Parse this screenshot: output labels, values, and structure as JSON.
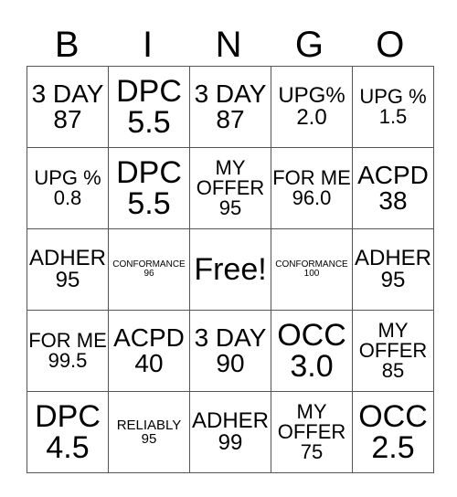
{
  "header": {
    "letters": [
      "B",
      "I",
      "N",
      "G",
      "O"
    ]
  },
  "card": {
    "rows": [
      [
        {
          "text": "3 DAY 87",
          "size": "l"
        },
        {
          "text": "DPC 5.5",
          "size": "xl"
        },
        {
          "text": "3 DAY 87",
          "size": "l"
        },
        {
          "text": "UPG% 2.0",
          "size": "m"
        },
        {
          "text": "UPG % 1.5",
          "size": "ms"
        }
      ],
      [
        {
          "text": "UPG % 0.8",
          "size": "ms"
        },
        {
          "text": "DPC 5.5",
          "size": "xl"
        },
        {
          "text": "MY OFFER 95",
          "size": "ms"
        },
        {
          "text": "FOR ME 96.0",
          "size": "ms"
        },
        {
          "text": "ACPD 38",
          "size": "l"
        }
      ],
      [
        {
          "text": "ADHER 95",
          "size": "m"
        },
        {
          "text": "CONFORMANCE 96",
          "size": "xs"
        },
        {
          "text": "Free!",
          "size": "xl"
        },
        {
          "text": "CONFORMANCE 100",
          "size": "xs"
        },
        {
          "text": "ADHER 95",
          "size": "m"
        }
      ],
      [
        {
          "text": "FOR ME 99.5",
          "size": "ms"
        },
        {
          "text": "ACPD 40",
          "size": "l"
        },
        {
          "text": "3 DAY 90",
          "size": "l"
        },
        {
          "text": "OCC 3.0",
          "size": "xl"
        },
        {
          "text": "MY OFFER 85",
          "size": "ms"
        }
      ],
      [
        {
          "text": "DPC 4.5",
          "size": "xl"
        },
        {
          "text": "RELIABLY 95",
          "size": "s"
        },
        {
          "text": "ADHER 99",
          "size": "m"
        },
        {
          "text": "MY OFFER 75",
          "size": "ms"
        },
        {
          "text": "OCC 2.5",
          "size": "xl"
        }
      ]
    ]
  }
}
